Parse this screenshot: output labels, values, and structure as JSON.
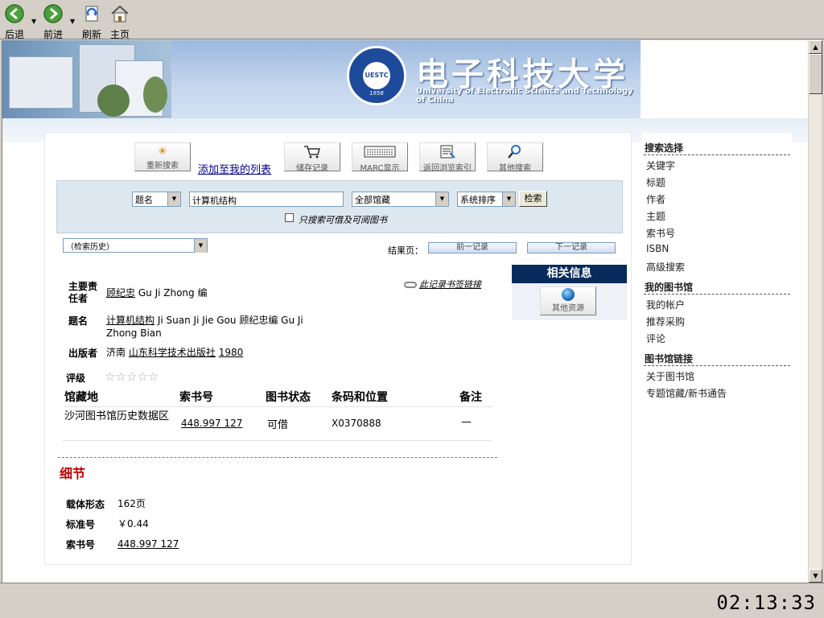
{
  "browser": {
    "back_label": "后退",
    "forward_label": "前进",
    "refresh_label": "刷新",
    "home_label": "主页"
  },
  "banner": {
    "logo_text": "UESTC",
    "logo_year": "1956",
    "university_name": "电子科技大学",
    "university_name_en": "University of Electronic Science and Technology of China"
  },
  "actions": {
    "new_search": "重新搜索",
    "add_to_list": "添加至我的列表",
    "save_record": "储存记录",
    "marc_view": "MARC显示",
    "back_to_browse": "返回浏览索引",
    "other_search": "其他搜索"
  },
  "search": {
    "field_select": "题名",
    "query": "计算机结构",
    "library_select": "全部馆藏",
    "sort_select": "系统排序",
    "search_button": "检索",
    "available_only_label": "只搜索可借及可阅图书"
  },
  "results_nav": {
    "history_select": "（检索历史）",
    "result_page_label": "结果页：",
    "prev_record": "前一记录",
    "next_record": "下一记录"
  },
  "related": {
    "title": "相关信息",
    "other_resources": "其他资源"
  },
  "record": {
    "permalink": "此记录书签链接",
    "author_label": "主要责任者",
    "author_link": "顾纪忠",
    "author_rest": "Gu Ji Zhong 编",
    "title_label": "题名",
    "title_link": "计算机结构",
    "title_rest": "Ji Suan Ji Jie Gou 顾纪忠编 Gu Ji Zhong Bian",
    "publisher_label": "出版者",
    "publisher_place": "济南",
    "publisher_link": "山东科学技术出版社",
    "publisher_year": "1980",
    "rating_label": "评级",
    "rating_stars": "☆☆☆☆☆"
  },
  "holdings": {
    "headers": [
      "馆藏地",
      "索书号",
      "图书状态",
      "条码和位置",
      "备注"
    ],
    "rows": [
      {
        "location": "沙河图书馆历史数据区",
        "call_number": "448.997 127",
        "status": "可借",
        "barcode": "X0370888",
        "note": "—"
      }
    ]
  },
  "details": {
    "title": "细节",
    "fields": [
      {
        "label": "载体形态",
        "value": "162页"
      },
      {
        "label": "标准号",
        "value": "￥0.44"
      },
      {
        "label": "索书号",
        "value": "448.997 127"
      }
    ]
  },
  "sidebar": {
    "search_options_title": "搜索选择",
    "search_options": [
      "关键字",
      "标题",
      "作者",
      "主题",
      "索书号",
      "ISBN",
      "高级搜索"
    ],
    "my_library_title": "我的图书馆",
    "my_library": [
      "我的帐户",
      "推荐采购",
      "评论"
    ],
    "library_links_title": "图书馆链接",
    "library_links": [
      "关于图书馆",
      "专题馆藏/新书通告"
    ]
  },
  "clock": "02:13:33",
  "colors": {
    "related_header_bg": "#062b5b",
    "details_title": "#c00000",
    "banner_blue": "#1d4a9a"
  }
}
